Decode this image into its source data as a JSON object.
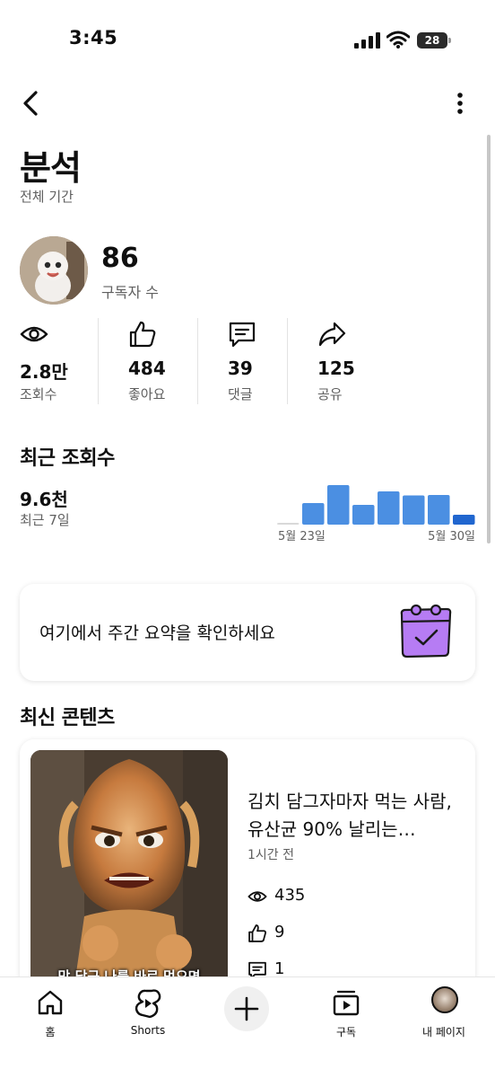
{
  "status_bar": {
    "time": "3:45",
    "battery": "28"
  },
  "header": {
    "back_icon": "chevron-left-icon",
    "more_icon": "more-vert-icon"
  },
  "page": {
    "title": "분석",
    "subtitle": "전체 기간"
  },
  "channel": {
    "subscriber_count": "86",
    "subscriber_label": "구독자 수"
  },
  "stats": [
    {
      "icon": "eye-icon",
      "value": "2.8만",
      "label": "조회수"
    },
    {
      "icon": "thumbs-up-icon",
      "value": "484",
      "label": "좋아요"
    },
    {
      "icon": "comment-icon",
      "value": "39",
      "label": "댓글"
    },
    {
      "icon": "share-icon",
      "value": "125",
      "label": "공유"
    }
  ],
  "recent_views": {
    "title": "최근 조회수",
    "value": "9.6천",
    "period": "최근 7일"
  },
  "chart_data": {
    "type": "bar",
    "categories": [
      "5월 23일",
      "5월 24일",
      "5월 25일",
      "5월 26일",
      "5월 27일",
      "5월 28일",
      "5월 29일",
      "5월 30일"
    ],
    "values": [
      2,
      48,
      88,
      44,
      74,
      65,
      66,
      22
    ],
    "tick_labels": [
      "5월 23일",
      "5월 30일"
    ],
    "colors": {
      "bar": "#4b8fe2",
      "last_bar": "#2066cf",
      "zero_bar": "#d9d9d9"
    }
  },
  "summary_card": {
    "text": "여기에서 주간 요약을 확인하세요",
    "icon": "calendar-check-icon",
    "accent": "#b67cf4"
  },
  "latest_content": {
    "title": "최신 콘텐츠",
    "video": {
      "caption": "막 담근 나를 바로 먹으면",
      "title": "김치 담그자마자 먹는 사람, 유산균 90% 날리는…",
      "time": "1시간 전",
      "views": "435",
      "likes": "9",
      "comments": "1"
    }
  },
  "bottom_nav": {
    "home": "홈",
    "shorts": "Shorts",
    "subscriptions": "구독",
    "my_page": "내 페이지"
  }
}
